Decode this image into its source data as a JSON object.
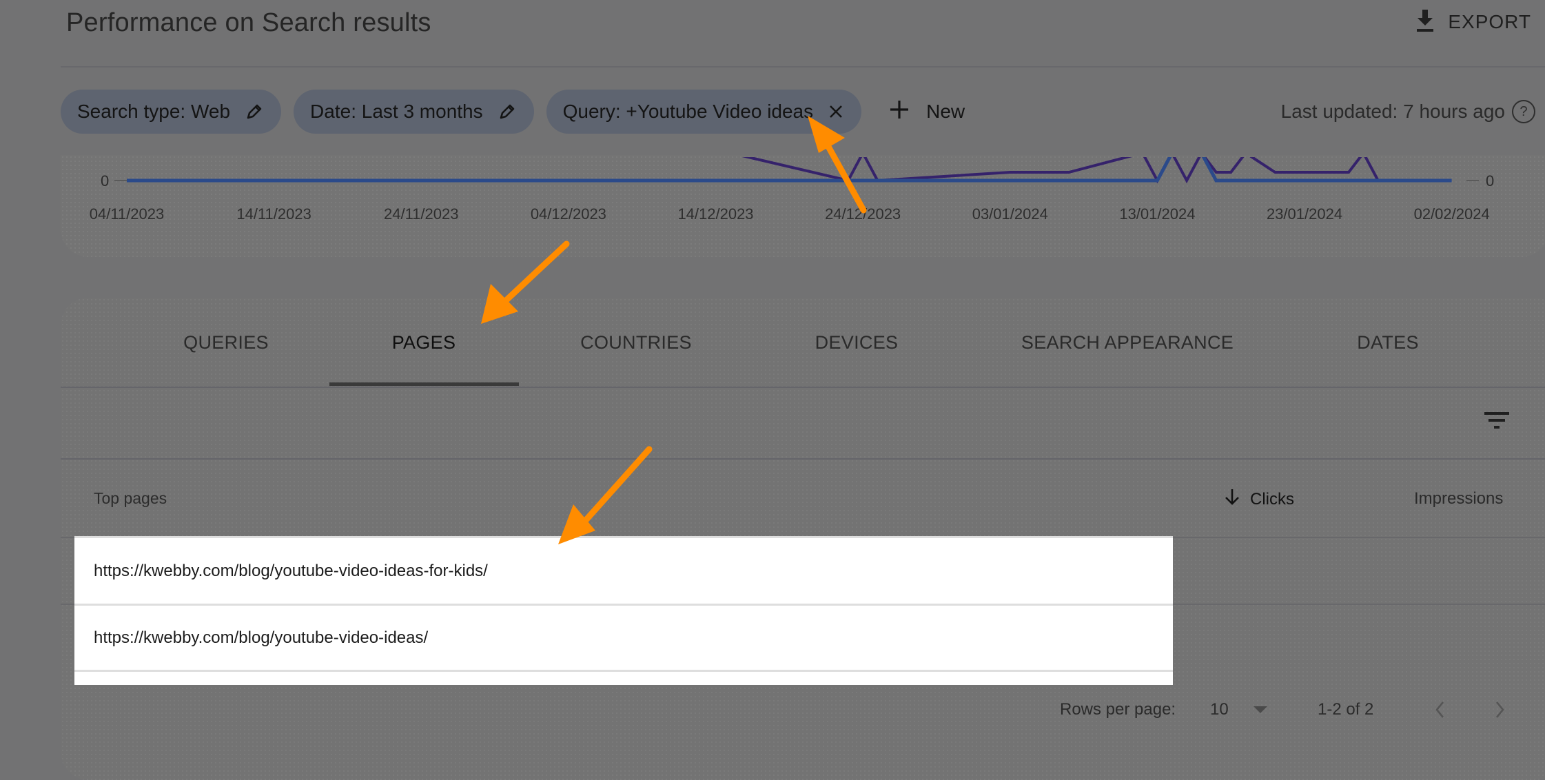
{
  "header": {
    "title": "Performance on Search results",
    "export_label": "EXPORT",
    "export_icon": "download-icon"
  },
  "filters": {
    "chips": [
      {
        "label": "Search type: Web",
        "icon": "pencil-icon"
      },
      {
        "label": "Date: Last 3 months",
        "icon": "pencil-icon"
      },
      {
        "label": "Query: +Youtube Video ideas",
        "icon": "close-icon"
      }
    ],
    "new_label": "New",
    "new_icon": "plus-icon",
    "last_updated": "Last updated: 7 hours ago",
    "help_icon": "help-circle-icon",
    "help_glyph": "?"
  },
  "chart_data": {
    "type": "line",
    "title": "",
    "xlabel": "",
    "ylabel": "",
    "y_left_tick_labels": [
      "0"
    ],
    "y_right_tick_labels": [
      "0"
    ],
    "x_tick_labels": [
      "04/11/2023",
      "14/11/2023",
      "24/11/2023",
      "04/12/2023",
      "14/12/2023",
      "24/12/2023",
      "03/01/2024",
      "13/01/2024",
      "23/01/2024",
      "02/02/2024"
    ],
    "x_range": [
      "04/11/2023",
      "03/02/2024"
    ],
    "grid": true,
    "colors": {
      "clicks": "#2b4a8a",
      "impressions": "#35226b",
      "axis": "#5a5a5a"
    },
    "note": "Upper portion of chart is cropped; only baseline and spikes near zero visible",
    "series": [
      {
        "name": "Clicks",
        "day_offsets": [
          0,
          70,
          71,
          73,
          74,
          90
        ],
        "values": [
          0,
          0,
          1,
          1,
          0,
          0
        ]
      },
      {
        "name": "Impressions",
        "day_offsets": [
          41,
          49,
          50,
          51,
          60,
          64,
          69,
          70,
          71,
          72,
          73,
          74,
          75,
          76,
          78,
          81,
          82,
          83,
          84,
          85,
          86,
          87,
          88
        ],
        "values": [
          1,
          0,
          1,
          0,
          0.3,
          0.3,
          1,
          0,
          1,
          0,
          1,
          0.3,
          0.3,
          1,
          0.3,
          0.3,
          0.3,
          0.3,
          1,
          0,
          0,
          0,
          0
        ]
      }
    ]
  },
  "tabs": {
    "items": [
      {
        "label": "QUERIES",
        "active": false
      },
      {
        "label": "PAGES",
        "active": true
      },
      {
        "label": "COUNTRIES",
        "active": false
      },
      {
        "label": "DEVICES",
        "active": false
      },
      {
        "label": "SEARCH APPEARANCE",
        "active": false
      },
      {
        "label": "DATES",
        "active": false
      }
    ]
  },
  "table": {
    "filter_icon": "filter-icon",
    "columns": {
      "page": "Top pages",
      "clicks": "Clicks",
      "clicks_sort_icon": "arrow-down-icon",
      "impressions": "Impressions"
    },
    "rows": [
      {
        "url": "https://kwebby.com/blog/youtube-video-ideas-for-kids/",
        "clicks": "",
        "impressions": ""
      },
      {
        "url": "https://kwebby.com/blog/youtube-video-ideas/",
        "clicks": "",
        "impressions": ""
      }
    ],
    "pagination": {
      "rows_per_page_label": "Rows per page:",
      "rows_per_page_value": "10",
      "range": "1-2 of 2",
      "prev_icon": "chevron-left-icon",
      "next_icon": "chevron-right-icon"
    }
  },
  "annotations": {
    "arrow_color": "#ff8c00",
    "arrows": [
      "arrow-to-query-chip",
      "arrow-to-pages-tab",
      "arrow-to-page-rows"
    ]
  }
}
